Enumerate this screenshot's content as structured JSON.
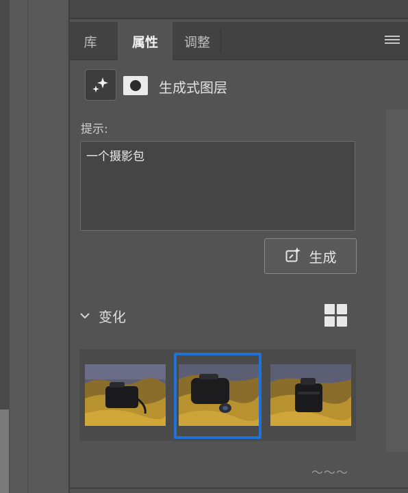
{
  "panel": {
    "tabs": [
      {
        "label": "库",
        "active": false
      },
      {
        "label": "属性",
        "active": true
      },
      {
        "label": "调整",
        "active": false
      }
    ]
  },
  "layer": {
    "type_icon": "sparkle-icon",
    "mask_icon": "mask-icon",
    "name": "生成式图层"
  },
  "prompt": {
    "label": "提示:",
    "value": "一个摄影包"
  },
  "generate": {
    "label": "生成",
    "icon": "generate-icon"
  },
  "variations": {
    "label": "变化",
    "collapse_icon": "chevron-down-icon",
    "view_icon": "grid-icon",
    "selected_index": 1,
    "count": 3
  },
  "watermark": "〜〜〜",
  "colors": {
    "selection": "#1e72d8",
    "panel_bg": "#535353",
    "tab_bar_bg": "#424242"
  }
}
